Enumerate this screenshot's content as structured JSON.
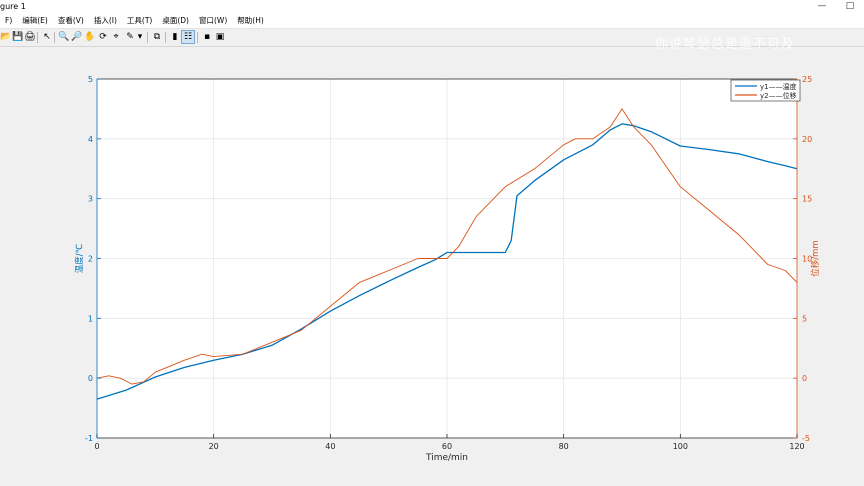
{
  "window": {
    "title": "gure 1",
    "controls": [
      "—",
      "□"
    ]
  },
  "watermark": "你说琴瑟总是遥不可及",
  "menus": [
    "F)",
    "编辑(E)",
    "查看(V)",
    "插入(I)",
    "工具(T)",
    "桌面(D)",
    "窗口(W)",
    "帮助(H)"
  ],
  "toolbar": {
    "buttons": [
      {
        "name": "open-icon",
        "glyph": "📂"
      },
      {
        "name": "save-icon",
        "glyph": "💾"
      },
      {
        "name": "print-icon",
        "glyph": "🖨"
      },
      {
        "name": "select-arrow-icon",
        "glyph": "↖"
      },
      {
        "name": "zoom-in-icon",
        "glyph": "🔍"
      },
      {
        "name": "zoom-out-icon",
        "glyph": "🔎"
      },
      {
        "name": "pan-hand-icon",
        "glyph": "✋"
      },
      {
        "name": "rotate-3d-icon",
        "glyph": "⟳"
      },
      {
        "name": "data-cursor-icon",
        "glyph": "⌖"
      },
      {
        "name": "brush-icon",
        "glyph": "✎"
      },
      {
        "name": "brush-dropdown-icon",
        "glyph": "▾"
      },
      {
        "name": "link-plot-icon",
        "glyph": "⧉"
      },
      {
        "name": "colorbar-icon",
        "glyph": "▮"
      },
      {
        "name": "legend-icon",
        "glyph": "☷"
      },
      {
        "name": "hide-tools-icon",
        "glyph": "▪"
      },
      {
        "name": "show-tools-icon",
        "glyph": "▣"
      }
    ]
  },
  "chart_data": {
    "type": "line",
    "xlabel": "Time/min",
    "ylabel_left": "温度/℃",
    "ylabel_right": "位移/mm",
    "xlim": [
      0,
      120
    ],
    "ylim_left": [
      -1,
      5
    ],
    "ylim_right": [
      -5,
      25
    ],
    "x_ticks": [
      "0",
      "20",
      "40",
      "60",
      "80",
      "100",
      "120"
    ],
    "y_left_ticks": [
      "-1",
      "0",
      "1",
      "2",
      "3",
      "4",
      "5"
    ],
    "y_right_ticks": [
      "-5",
      "0",
      "5",
      "10",
      "15",
      "20",
      "25"
    ],
    "grid": true,
    "legend_position": "top-right",
    "colors": {
      "y1": "#0072bd",
      "y2": "#d95319",
      "grid": "#e6e6e6"
    },
    "series": [
      {
        "name": "y1——温度",
        "axis": "left",
        "x": [
          0,
          5,
          10,
          15,
          20,
          25,
          30,
          35,
          40,
          45,
          50,
          55,
          58,
          60,
          65,
          70,
          71,
          72,
          75,
          80,
          85,
          88,
          90,
          92,
          95,
          100,
          105,
          110,
          115,
          118,
          120
        ],
        "y": [
          -0.35,
          -0.2,
          0.02,
          0.18,
          0.3,
          0.4,
          0.55,
          0.82,
          1.12,
          1.38,
          1.62,
          1.85,
          1.98,
          2.1,
          2.1,
          2.1,
          2.3,
          3.05,
          3.3,
          3.65,
          3.9,
          4.15,
          4.25,
          4.22,
          4.12,
          3.88,
          3.82,
          3.75,
          3.62,
          3.55,
          3.5
        ]
      },
      {
        "name": "y2——位移",
        "axis": "right",
        "x": [
          0,
          2,
          4,
          6,
          8,
          10,
          15,
          18,
          20,
          25,
          30,
          35,
          40,
          45,
          50,
          55,
          58,
          60,
          62,
          65,
          70,
          75,
          80,
          82,
          85,
          88,
          90,
          92,
          95,
          100,
          105,
          110,
          115,
          118,
          120
        ],
        "y": [
          0,
          0.2,
          0,
          -0.5,
          -0.3,
          0.5,
          1.5,
          2,
          1.8,
          2,
          3,
          4,
          6,
          8,
          9,
          10,
          10,
          10,
          11,
          13.5,
          16,
          17.5,
          19.5,
          20,
          20,
          21,
          22.5,
          21,
          19.5,
          16,
          14,
          12,
          9.5,
          9,
          8
        ]
      }
    ]
  }
}
